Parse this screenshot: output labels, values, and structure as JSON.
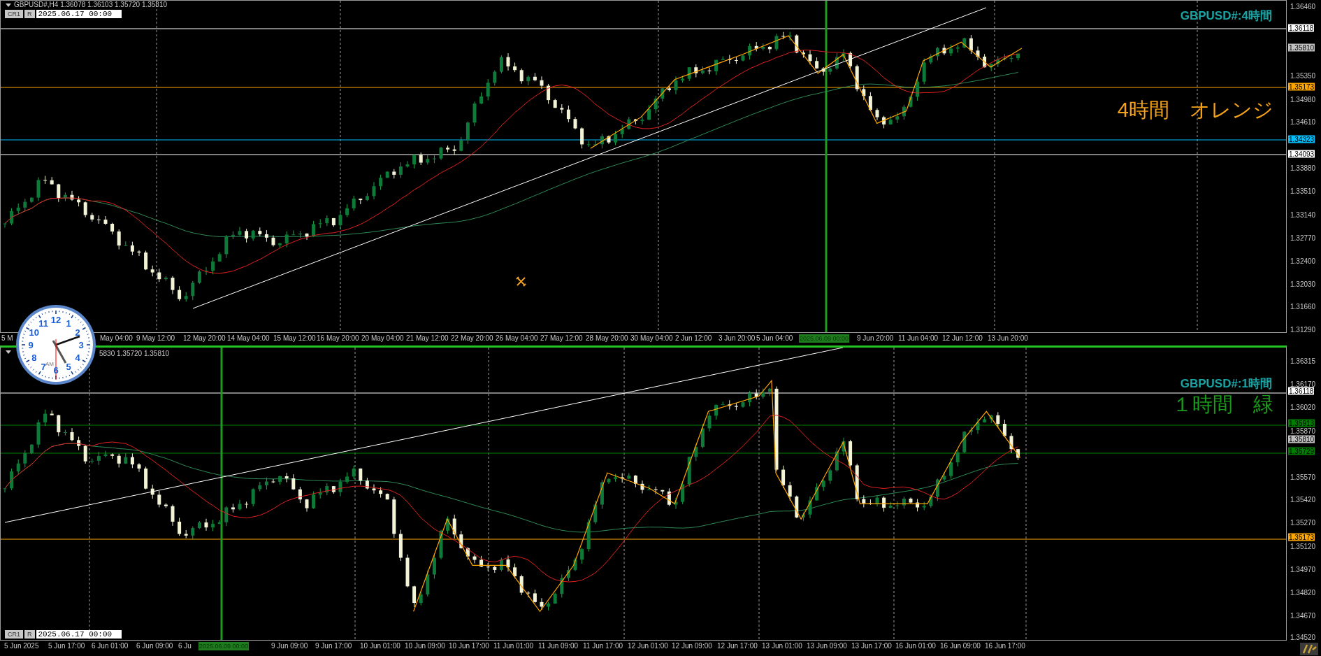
{
  "panels": [
    {
      "header": "GBPUSD#,H4 1.36078 1.36103 1.35720 1.35810",
      "buttons": [
        "CR1",
        "R"
      ],
      "date_field": "2025.06.17 00:00",
      "title": "GBPUSD#:4時間",
      "note": {
        "text": "4時間　オレンジ",
        "color": "#f5a21b"
      },
      "price_axis": [
        {
          "text": "1.36460",
          "kind": "tick"
        },
        {
          "text": "1.36118",
          "kind": "marker",
          "color": "#ffffff",
          "line": true
        },
        {
          "text": "1.35810",
          "kind": "marker",
          "color": "#c0c0c0",
          "line": false
        },
        {
          "text": "1.35350",
          "kind": "tick"
        },
        {
          "text": "1.35173",
          "kind": "marker",
          "color": "#ffa500",
          "line": true
        },
        {
          "text": "1.34980",
          "kind": "tick"
        },
        {
          "text": "1.34610",
          "kind": "tick"
        },
        {
          "text": "1.34323",
          "kind": "marker",
          "color": "#00bfff",
          "line": true
        },
        {
          "text": "1.34093",
          "kind": "marker",
          "color": "#ffffff",
          "line": true
        },
        {
          "text": "1.33880",
          "kind": "tick"
        },
        {
          "text": "1.33510",
          "kind": "tick"
        },
        {
          "text": "1.33140",
          "kind": "tick"
        },
        {
          "text": "1.32770",
          "kind": "tick"
        },
        {
          "text": "1.32400",
          "kind": "tick"
        },
        {
          "text": "1.32030",
          "kind": "tick"
        },
        {
          "text": "1.31660",
          "kind": "tick"
        },
        {
          "text": "1.31290",
          "kind": "tick"
        }
      ],
      "time_axis": [
        {
          "text": "5 M",
          "kind": "tick"
        },
        {
          "text": "May 04:00",
          "kind": "tick"
        },
        {
          "text": "9 May 12:00",
          "kind": "tick"
        },
        {
          "text": "12 May 20:00",
          "kind": "tick"
        },
        {
          "text": "14 May 04:00",
          "kind": "tick"
        },
        {
          "text": "15 May 12:00",
          "kind": "tick"
        },
        {
          "text": "16 May 20:00",
          "kind": "tick"
        },
        {
          "text": "20 May 04:00",
          "kind": "tick"
        },
        {
          "text": "21 May 12:00",
          "kind": "tick"
        },
        {
          "text": "22 May 20:00",
          "kind": "tick"
        },
        {
          "text": "26 May 04:00",
          "kind": "tick"
        },
        {
          "text": "27 May 12:00",
          "kind": "tick"
        },
        {
          "text": "28 May 20:00",
          "kind": "tick"
        },
        {
          "text": "30 May 04:00",
          "kind": "tick"
        },
        {
          "text": "2 Jun 12:00",
          "kind": "tick"
        },
        {
          "text": "3 Jun 20:00",
          "kind": "tick"
        },
        {
          "text": "5 Jun 04:00",
          "kind": "tick"
        },
        {
          "text": "2025.06.09 00:00",
          "kind": "cursor"
        },
        {
          "text": "9 Jun 20:00",
          "kind": "tick"
        },
        {
          "text": "11 Jun 04:00",
          "kind": "tick"
        },
        {
          "text": "12 Jun 12:00",
          "kind": "tick"
        },
        {
          "text": "13 Jun 20:00",
          "kind": "tick"
        }
      ]
    },
    {
      "header": "5830 1.35720 1.35810",
      "buttons": [
        "CR1",
        "R"
      ],
      "date_field": "2025.06.17 00:00",
      "title": "GBPUSD#:1時間",
      "note": {
        "text": "１時間　緑",
        "color": "#1a9a1a"
      },
      "price_axis": [
        {
          "text": "1.36315",
          "kind": "tick"
        },
        {
          "text": "1.36170",
          "kind": "tick"
        },
        {
          "text": "1.36118",
          "kind": "marker",
          "color": "#ffffff",
          "line": true
        },
        {
          "text": "1.36020",
          "kind": "tick"
        },
        {
          "text": "1.35913",
          "kind": "marker",
          "color": "#008000",
          "line": true
        },
        {
          "text": "1.35870",
          "kind": "tick"
        },
        {
          "text": "1.35810",
          "kind": "marker",
          "color": "#c0c0c0",
          "line": false
        },
        {
          "text": "1.35729",
          "kind": "marker",
          "color": "#008000",
          "line": true
        },
        {
          "text": "1.35570",
          "kind": "tick"
        },
        {
          "text": "1.35420",
          "kind": "tick"
        },
        {
          "text": "1.35270",
          "kind": "tick"
        },
        {
          "text": "1.35173",
          "kind": "marker",
          "color": "#ffa500",
          "line": true
        },
        {
          "text": "1.35120",
          "kind": "tick"
        },
        {
          "text": "1.34970",
          "kind": "tick"
        },
        {
          "text": "1.34820",
          "kind": "tick"
        },
        {
          "text": "1.34670",
          "kind": "tick"
        },
        {
          "text": "1.34520",
          "kind": "tick"
        }
      ],
      "time_axis": [
        {
          "text": "5 Jun 2025",
          "kind": "tick"
        },
        {
          "text": "5 Jun 17:00",
          "kind": "tick"
        },
        {
          "text": "6 Jun 01:00",
          "kind": "tick"
        },
        {
          "text": "6 Jun 09:00",
          "kind": "tick"
        },
        {
          "text": "6 Ju",
          "kind": "tick"
        },
        {
          "text": "2025.06.09 00:00",
          "kind": "cursor"
        },
        {
          "text": "9 Jun 09:00",
          "kind": "tick"
        },
        {
          "text": "9 Jun 17:00",
          "kind": "tick"
        },
        {
          "text": "10 Jun 01:00",
          "kind": "tick"
        },
        {
          "text": "10 Jun 09:00",
          "kind": "tick"
        },
        {
          "text": "10 Jun 17:00",
          "kind": "tick"
        },
        {
          "text": "11 Jun 01:00",
          "kind": "tick"
        },
        {
          "text": "11 Jun 09:00",
          "kind": "tick"
        },
        {
          "text": "11 Jun 17:00",
          "kind": "tick"
        },
        {
          "text": "12 Jun 01:00",
          "kind": "tick"
        },
        {
          "text": "12 Jun 09:00",
          "kind": "tick"
        },
        {
          "text": "12 Jun 17:00",
          "kind": "tick"
        },
        {
          "text": "13 Jun 01:00",
          "kind": "tick"
        },
        {
          "text": "13 Jun 09:00",
          "kind": "tick"
        },
        {
          "text": "13 Jun 17:00",
          "kind": "tick"
        },
        {
          "text": "16 Jun 01:00",
          "kind": "tick"
        },
        {
          "text": "16 Jun 09:00",
          "kind": "tick"
        },
        {
          "text": "16 Jun 17:00",
          "kind": "tick"
        }
      ]
    }
  ],
  "clock": {
    "numerals": [
      "12",
      "11",
      "1",
      "10",
      "2",
      "9",
      "3",
      "8",
      "4",
      "7",
      "5",
      "6"
    ],
    "period": "AM"
  }
}
